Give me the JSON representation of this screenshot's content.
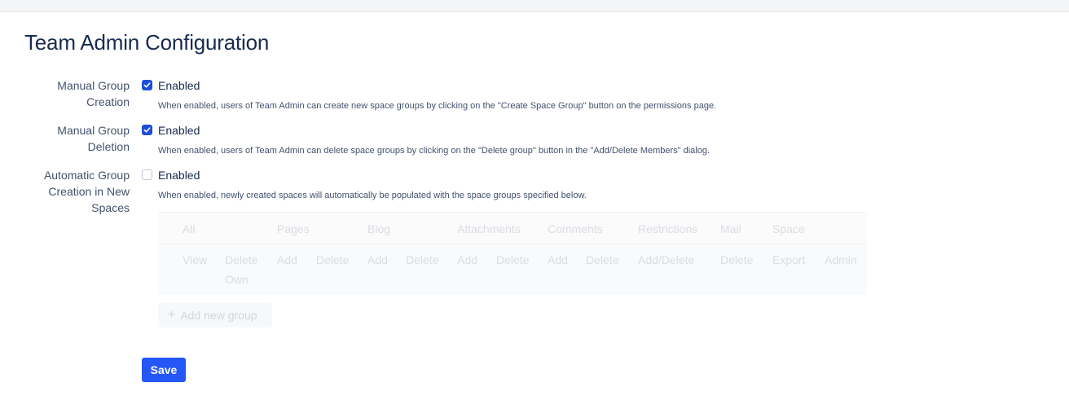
{
  "page": {
    "title": "Team Admin Configuration"
  },
  "settings": [
    {
      "label_lines": [
        "Manual Group",
        "Creation"
      ],
      "checked": true,
      "checkbox_label": "Enabled",
      "description": "When enabled, users of Team Admin can create new space groups by clicking on the \"Create Space Group\" button on the permissions page."
    },
    {
      "label_lines": [
        "Manual Group",
        "Deletion"
      ],
      "checked": true,
      "checkbox_label": "Enabled",
      "description": "When enabled, users of Team Admin can delete space groups by clicking on the \"Delete group\" button in the \"Add/Delete Members\" dialog."
    },
    {
      "label_lines": [
        "Automatic Group",
        "Creation in New",
        "Spaces"
      ],
      "checked": false,
      "checkbox_label": "Enabled",
      "description": "When enabled, newly created spaces will automatically be populated with the space groups specified below."
    }
  ],
  "groups_table": {
    "category_headers": [
      "All",
      "Pages",
      "Blog",
      "Attachments",
      "Comments",
      "Restrictions",
      "Mail",
      "Space"
    ],
    "permission_headers": [
      "View",
      "Delete Own",
      "Add",
      "Delete",
      "Add",
      "Delete",
      "Add",
      "Delete",
      "Add",
      "Delete",
      "Add/Delete",
      "Delete",
      "Export",
      "Admin"
    ]
  },
  "add_group_button": {
    "label": "Add new group",
    "icon": "plus-icon"
  },
  "save_button": {
    "label": "Save"
  },
  "colors": {
    "primary": "#2457f5",
    "checkbox_checked": "#1f4ed8",
    "title": "#172b4d"
  }
}
